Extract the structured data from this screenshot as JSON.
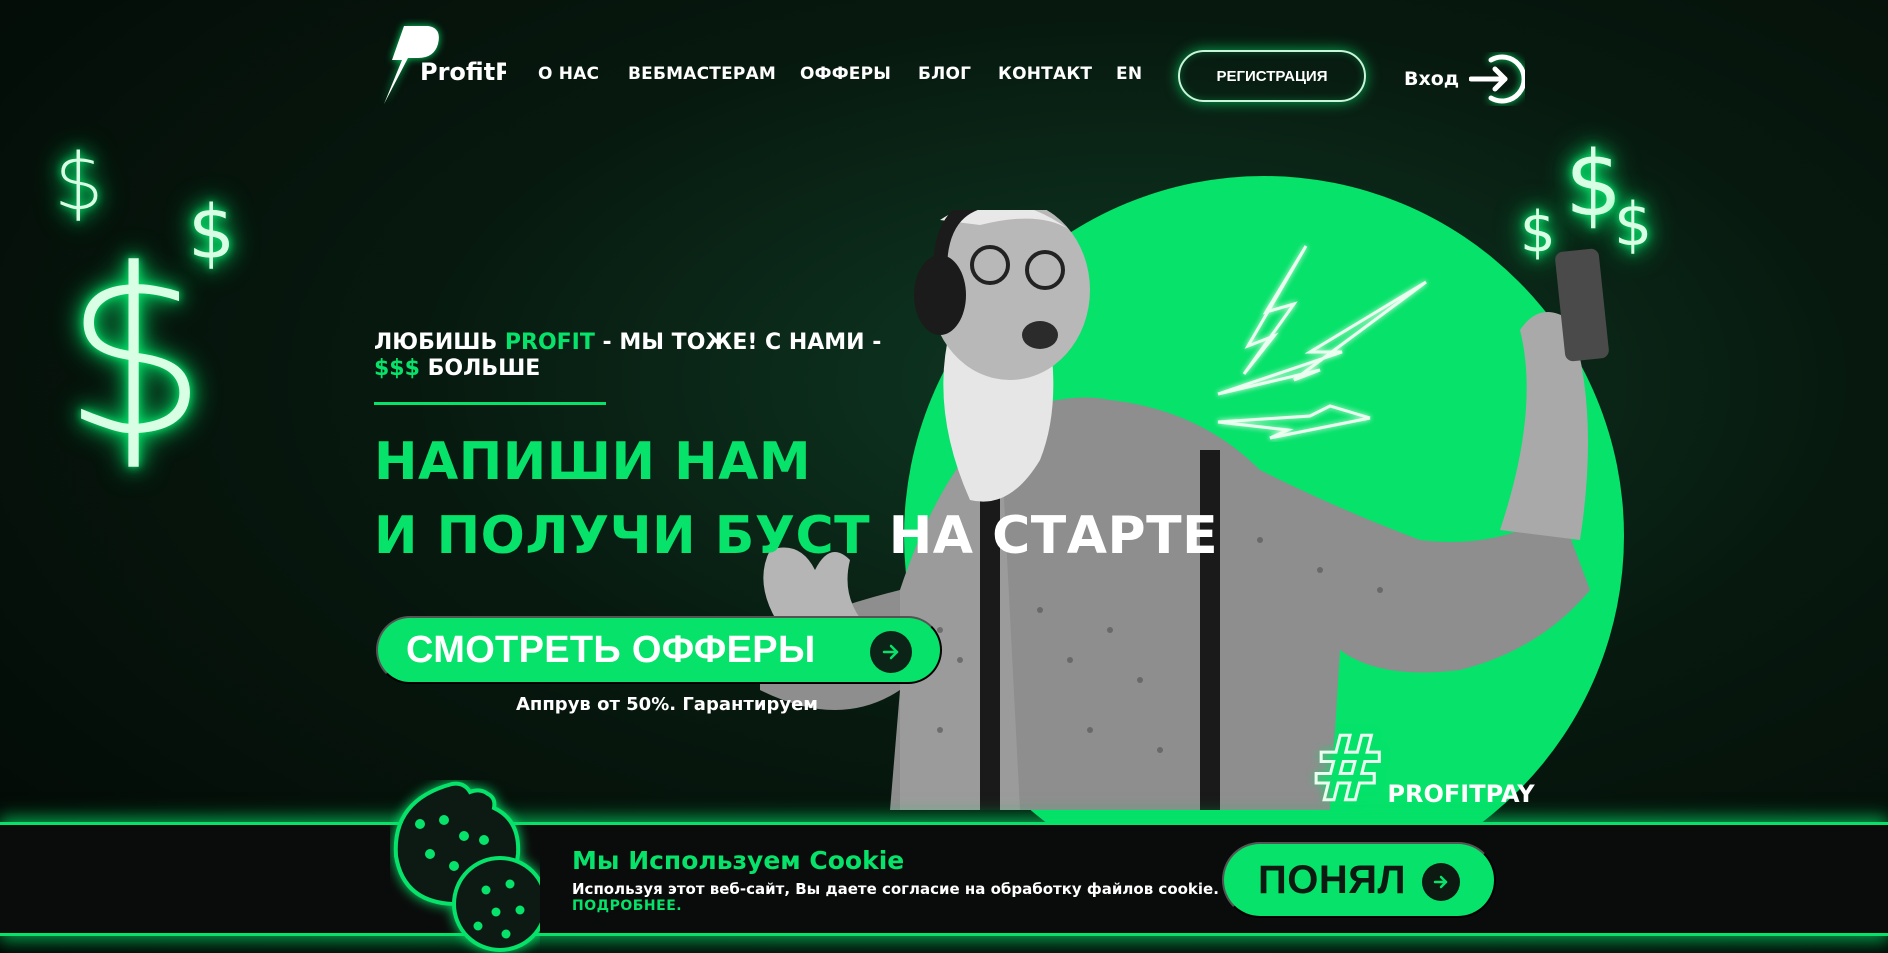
{
  "brand": {
    "name": "ProfitPay",
    "accent_color": "#06e26a",
    "background_color": "#07190f"
  },
  "nav": {
    "items": [
      {
        "label": "О НАС"
      },
      {
        "label": "ВЕБМАСТЕРАМ"
      },
      {
        "label": "ОФФЕРЫ"
      },
      {
        "label": "БЛОГ"
      },
      {
        "label": "КОНТАКТ"
      },
      {
        "label": "EN"
      }
    ],
    "register_label": "РЕГИСТРАЦИЯ",
    "login_label": "Вход",
    "login_icon": "login-arrow-icon"
  },
  "hero": {
    "tagline_part1": "ЛЮБИШЬ ",
    "tagline_accent1": "PROFIT",
    "tagline_part2": " - МЫ ТОЖЕ! С НАМИ -",
    "tagline_accent2": "$$$",
    "tagline_part3": " БОЛЬШЕ",
    "headline_line1": "НАПИШИ НАМ",
    "headline_line2_green": "И ПОЛУЧИ БУСТ",
    "headline_line2_white": " НА СТАРТЕ",
    "cta_label": "СМОТРЕТЬ ОФФЕРЫ",
    "cta_sub": "Аппрув от 50%. Гарантируем",
    "hashtag_label": "PROFITPAY"
  },
  "cookie": {
    "title": "Мы Используем Cookie",
    "text": "Используя этот веб-сайт, Вы даете согласие на обработку файлов cookie.",
    "more_label": "ПОДРОБНЕЕ.",
    "accept_label": "ПОНЯЛ"
  }
}
